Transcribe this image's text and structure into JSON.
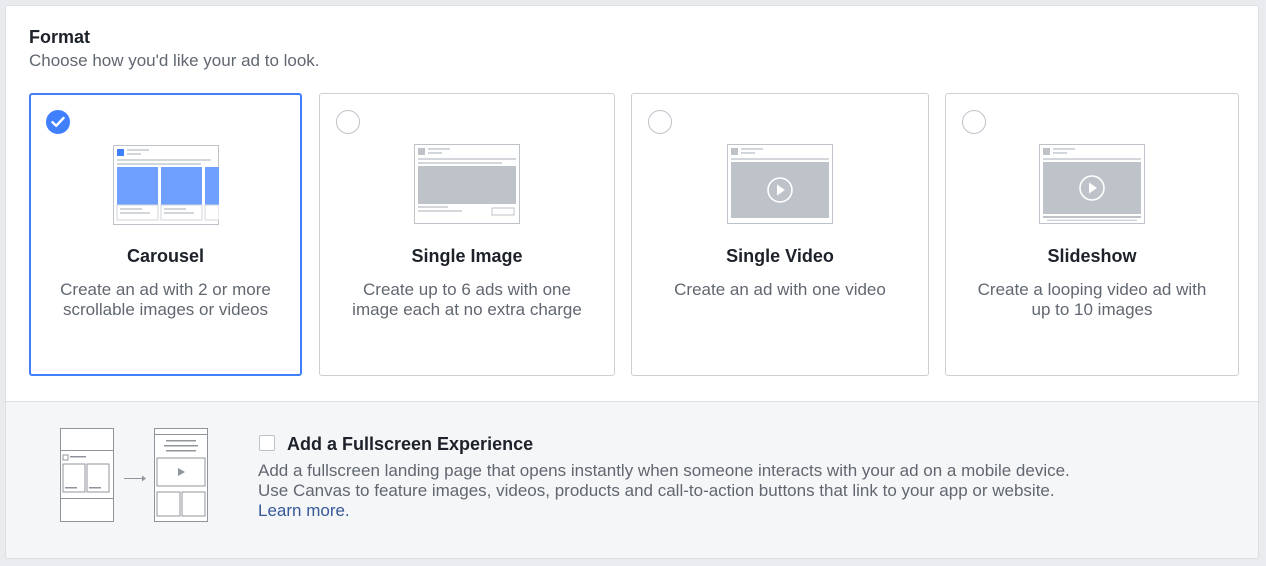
{
  "format": {
    "title": "Format",
    "subtitle": "Choose how you'd like your ad to look."
  },
  "options": [
    {
      "title": "Carousel",
      "description": "Create an ad with 2 or more scrollable images or videos",
      "selected": true,
      "icon": "carousel-preview-icon"
    },
    {
      "title": "Single Image",
      "description": "Create up to 6 ads with one image each at no extra charge",
      "selected": false,
      "icon": "single-image-preview-icon"
    },
    {
      "title": "Single Video",
      "description": "Create an ad with one video",
      "selected": false,
      "icon": "single-video-preview-icon"
    },
    {
      "title": "Slideshow",
      "description": "Create a looping video ad with up to 10 images",
      "selected": false,
      "icon": "slideshow-preview-icon"
    }
  ],
  "fullscreen": {
    "title": "Add a Fullscreen Experience",
    "checked": false,
    "description_line1": "Add a fullscreen landing page that opens instantly when someone interacts with your ad on a mobile device.",
    "description_line2": "Use Canvas to feature images, videos, products and call-to-action buttons that link to your app or website.",
    "learn_more": "Learn more."
  },
  "colors": {
    "accent": "#4080ff",
    "link": "#365899",
    "text_primary": "#1d2129",
    "text_secondary": "#616770",
    "thumb_gray": "#bec2c9",
    "footer_bg": "#f5f6f7"
  }
}
